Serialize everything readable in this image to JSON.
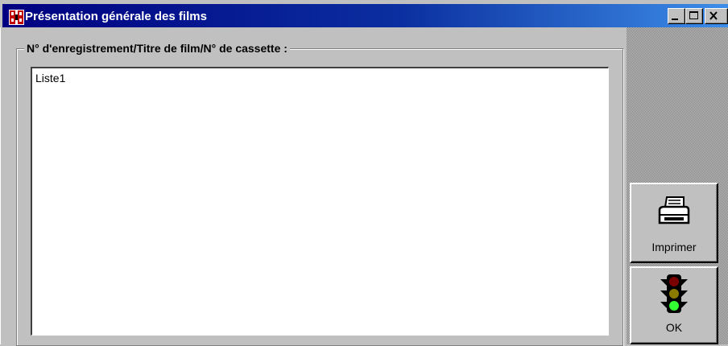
{
  "window": {
    "title": "Présentation générale des films",
    "controls": {
      "minimize": "_",
      "maximize": "□",
      "close": "×"
    }
  },
  "group": {
    "label": "N° d'enregistrement/Titre de film/N° de cassette :"
  },
  "list": {
    "items": [
      "Liste1"
    ]
  },
  "buttons": {
    "print": {
      "label": "Imprimer",
      "icon": "printer-icon"
    },
    "ok": {
      "label": "OK",
      "icon": "traffic-light-icon"
    }
  },
  "colors": {
    "titlebar_start": "#000080",
    "titlebar_end": "#3d8ee8",
    "face": "#c0c0c0"
  }
}
